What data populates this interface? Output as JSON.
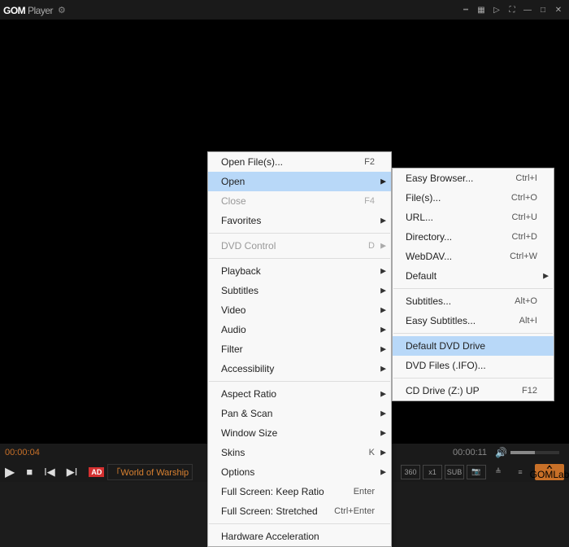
{
  "titlebar": {
    "logo_bold": "GOM",
    "logo_light": " Player"
  },
  "status": {
    "time_left": "00:00:04",
    "time_right": "00:00:11"
  },
  "ad": {
    "badge": "AD",
    "text": "「World of Warship"
  },
  "gomlab": "GOMLab",
  "menu1": {
    "items": [
      {
        "label": "Open File(s)...",
        "shortcut": "F2"
      },
      {
        "label": "Open",
        "arrow": true,
        "hl": true
      },
      {
        "label": "Close",
        "shortcut": "F4",
        "disabled": true
      },
      {
        "label": "Favorites",
        "arrow": true
      },
      {
        "sep": true
      },
      {
        "label": "DVD Control",
        "shortcut": "D",
        "arrow": true,
        "disabled": true
      },
      {
        "sep": true
      },
      {
        "label": "Playback",
        "arrow": true
      },
      {
        "label": "Subtitles",
        "arrow": true
      },
      {
        "label": "Video",
        "arrow": true
      },
      {
        "label": "Audio",
        "arrow": true
      },
      {
        "label": "Filter",
        "arrow": true
      },
      {
        "label": "Accessibility",
        "arrow": true
      },
      {
        "sep": true
      },
      {
        "label": "Aspect Ratio",
        "arrow": true
      },
      {
        "label": "Pan & Scan",
        "arrow": true
      },
      {
        "label": "Window Size",
        "arrow": true
      },
      {
        "label": "Skins",
        "shortcut": "K",
        "arrow": true
      },
      {
        "label": "Options",
        "arrow": true
      },
      {
        "label": "Full Screen: Keep Ratio",
        "shortcut": "Enter"
      },
      {
        "label": "Full Screen: Stretched",
        "shortcut": "Ctrl+Enter"
      },
      {
        "sep": true
      },
      {
        "label": "Hardware Acceleration"
      }
    ]
  },
  "menu2": {
    "items": [
      {
        "label": "Easy Browser...",
        "shortcut": "Ctrl+I"
      },
      {
        "label": "File(s)...",
        "shortcut": "Ctrl+O"
      },
      {
        "label": "URL...",
        "shortcut": "Ctrl+U"
      },
      {
        "label": "Directory...",
        "shortcut": "Ctrl+D"
      },
      {
        "label": "WebDAV...",
        "shortcut": "Ctrl+W"
      },
      {
        "label": "Default",
        "arrow": true
      },
      {
        "sep": true
      },
      {
        "label": "Subtitles...",
        "shortcut": "Alt+O"
      },
      {
        "label": "Easy Subtitles...",
        "shortcut": "Alt+I"
      },
      {
        "sep": true
      },
      {
        "label": "Default DVD Drive",
        "hl": true
      },
      {
        "label": "DVD Files (.IFO)..."
      },
      {
        "sep": true
      },
      {
        "label": "CD Drive (Z:) UP",
        "shortcut": "F12"
      }
    ]
  }
}
